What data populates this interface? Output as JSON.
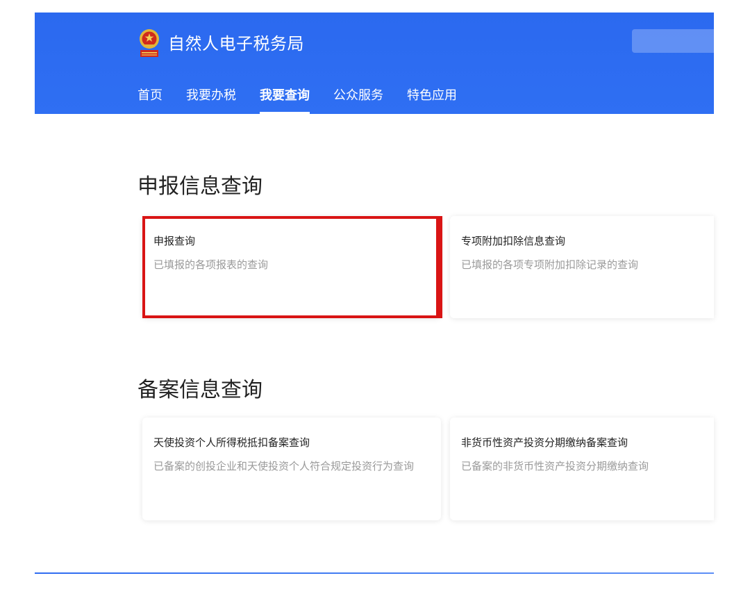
{
  "header": {
    "site_title": "自然人电子税务局",
    "nav": [
      {
        "label": "首页",
        "active": false
      },
      {
        "label": "我要办税",
        "active": false
      },
      {
        "label": "我要查询",
        "active": true
      },
      {
        "label": "公众服务",
        "active": false
      },
      {
        "label": "特色应用",
        "active": false
      }
    ],
    "brand_color": "#2f6cf1"
  },
  "sections": [
    {
      "title": "申报信息查询",
      "cards": [
        {
          "title": "申报查询",
          "desc": "已填报的各项报表的查询",
          "highlighted": true
        },
        {
          "title": "专项附加扣除信息查询",
          "desc": "已填报的各项专项附加扣除记录的查询"
        }
      ]
    },
    {
      "title": "备案信息查询",
      "cards": [
        {
          "title": "天使投资个人所得税抵扣备案查询",
          "desc": "已备案的创投企业和天使投资个人符合规定投资行为查询"
        },
        {
          "title": "非货币性资产投资分期缴纳备案查询",
          "desc": "已备案的非货币性资产投资分期缴纳查询"
        }
      ]
    }
  ],
  "highlight_color": "#d91414"
}
